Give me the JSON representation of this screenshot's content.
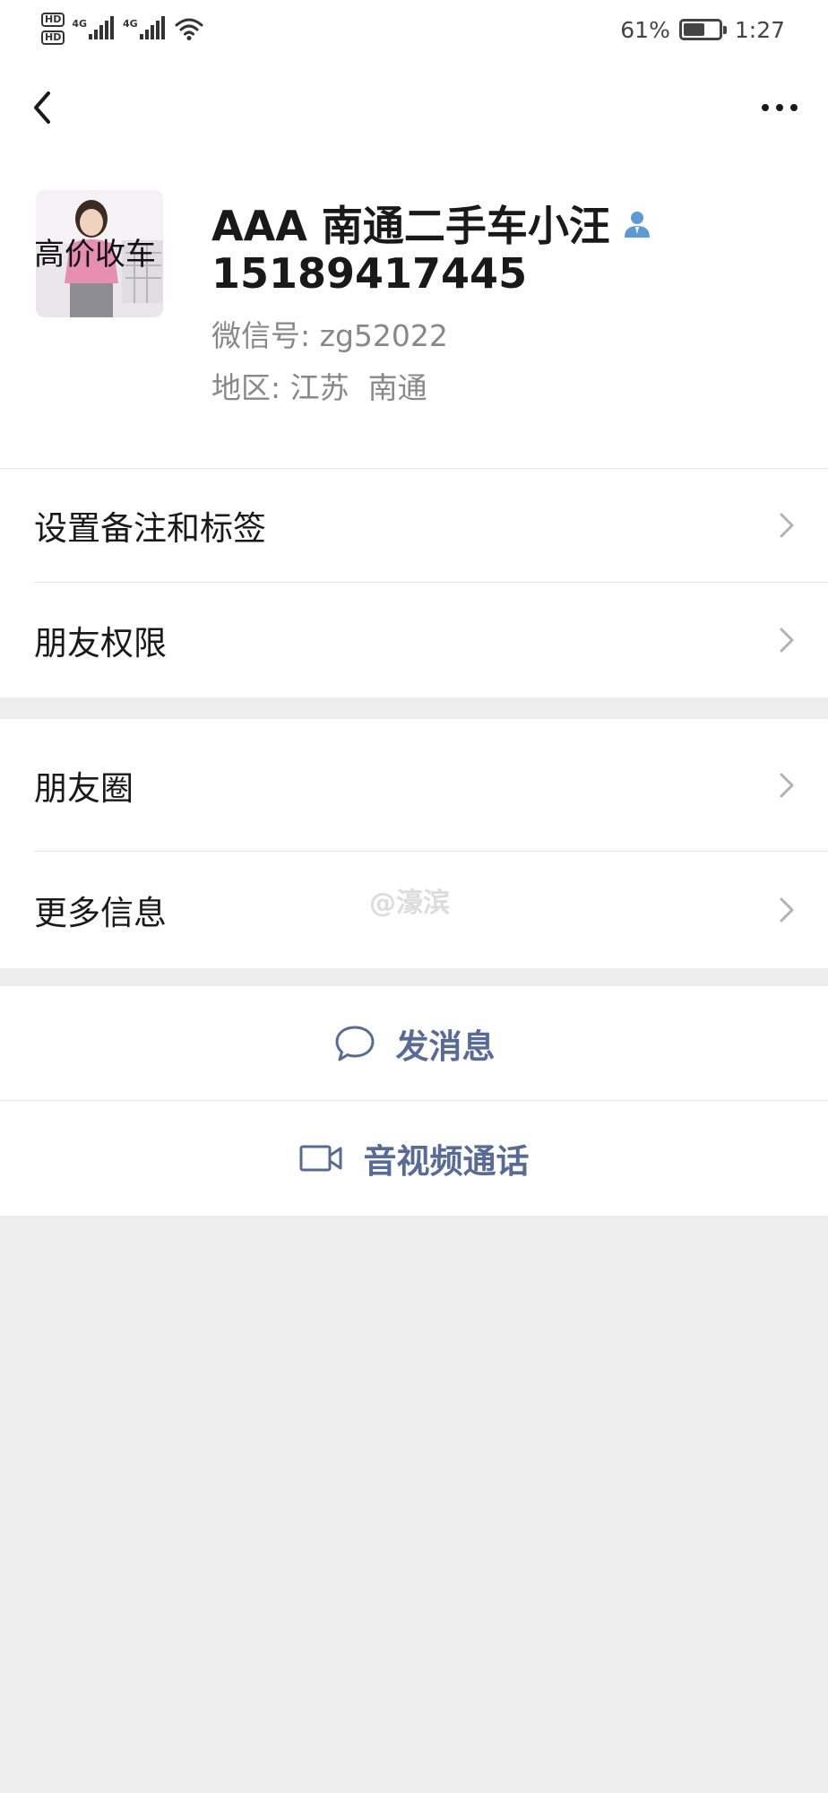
{
  "status_bar": {
    "hd1": "HD",
    "hd2": "HD",
    "sim1_network": "4G",
    "sim2_network": "4G",
    "battery_text": "61%",
    "battery_level": 0.61,
    "time": "1:27"
  },
  "nav": {
    "back_icon": "chevron-left-icon",
    "more_icon": "more-dots-icon"
  },
  "profile": {
    "avatar_text": "高价收车",
    "name": "AAA 南通二手车小汪",
    "phone": "15189417445",
    "wechat_id_label": "微信号:",
    "wechat_id": "zg52022",
    "region_label": "地区:",
    "region": "江苏  南通",
    "contact_icon": "person-icon",
    "contact_icon_color": "#5b9bd5"
  },
  "menu_group_1": [
    {
      "label": "设置备注和标签"
    },
    {
      "label": "朋友权限"
    }
  ],
  "menu_group_2": [
    {
      "label": "朋友圈"
    },
    {
      "label": "更多信息"
    }
  ],
  "watermark": "@濠滨",
  "actions": {
    "message_label": "发消息",
    "message_icon": "chat-bubble-icon",
    "video_call_label": "音视频通话",
    "video_call_icon": "video-camera-icon",
    "accent_color": "#576b95"
  }
}
